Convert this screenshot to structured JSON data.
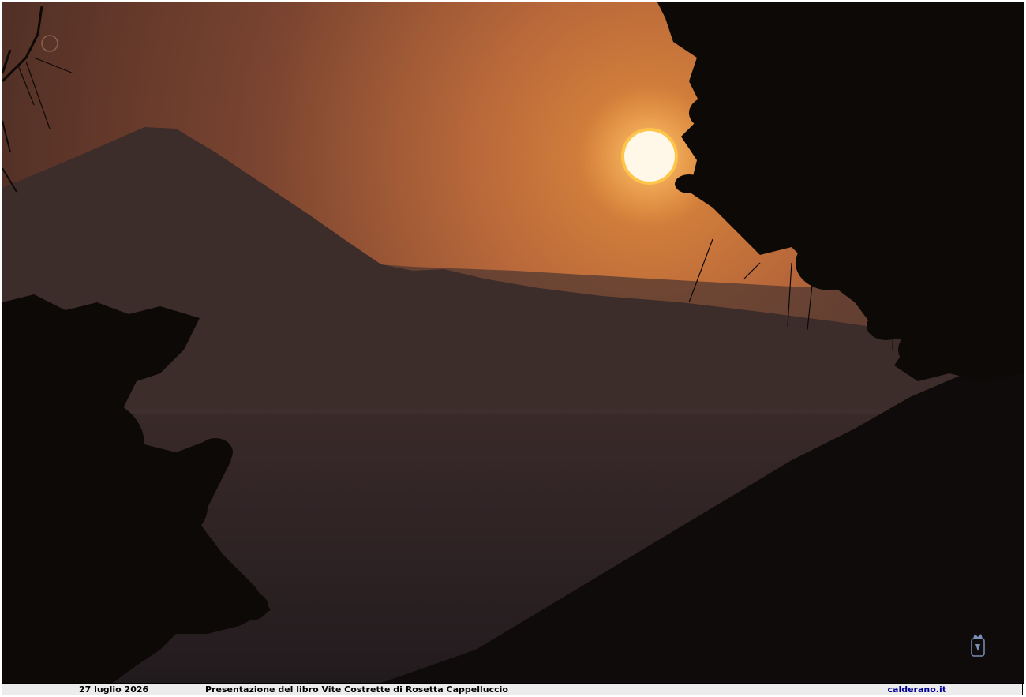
{
  "caption": {
    "date": "27 luglio 2026",
    "title": "Presentazione del libro Vite Costrette di Rosetta Cappelluccio",
    "site": "calderano.it"
  },
  "photo": {
    "scene": "sunset",
    "colors": {
      "sky_light": "#d9833a",
      "sky_dark": "#5a3224",
      "mountain": "#3a2a28",
      "sea": "#2b2224",
      "foliage": "#0d0907",
      "sun": "#fff8e8"
    }
  },
  "emblem": {
    "icon": "coat-of-arms-icon"
  }
}
